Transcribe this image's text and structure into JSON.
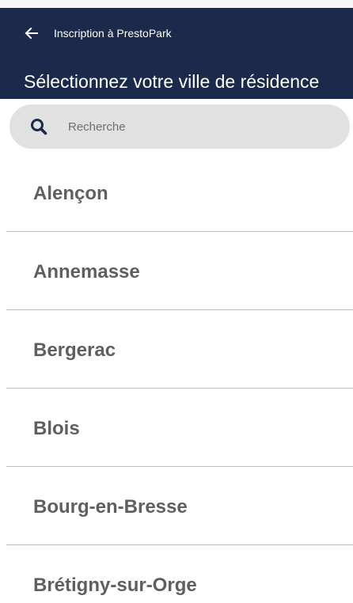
{
  "header": {
    "back_icon": "arrow-left-icon",
    "appbar_title": "Inscription à PrestoPark",
    "page_title": "Sélectionnez votre ville de résidence",
    "background_color": "#1b2a4a",
    "text_color": "#ffffff"
  },
  "search": {
    "icon": "search-icon",
    "placeholder": "Recherche",
    "value": ""
  },
  "cities": [
    {
      "label": "Alençon"
    },
    {
      "label": "Annemasse"
    },
    {
      "label": "Bergerac"
    },
    {
      "label": "Blois"
    },
    {
      "label": "Bourg-en-Bresse"
    },
    {
      "label": "Brétigny-sur-Orge"
    }
  ]
}
